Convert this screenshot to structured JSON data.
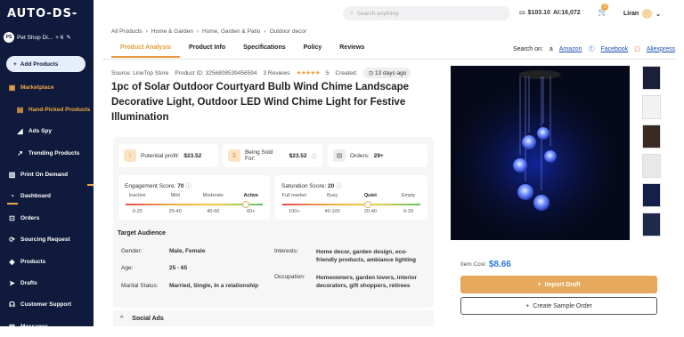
{
  "brand": "AUTO-DS-",
  "sidebar": {
    "store_initials": "PS",
    "store_name": "Pet Shop Di...",
    "store_extra": "+ 6",
    "add_products": "Add Products",
    "items": [
      {
        "label": "Marketplace"
      },
      {
        "label": "Hand-Picked Products"
      },
      {
        "label": "Ads Spy"
      },
      {
        "label": "Trending Products"
      },
      {
        "label": "Print On Demand"
      },
      {
        "label": "Dashboard"
      },
      {
        "label": "Orders"
      },
      {
        "label": "Sourcing Request"
      },
      {
        "label": "Products"
      },
      {
        "label": "Drafts"
      },
      {
        "label": "Customer Support"
      },
      {
        "label": "Messages"
      }
    ]
  },
  "topbar": {
    "search_placeholder": "Search anything",
    "balance": "$103.10",
    "ai_credits": "AI:16,072",
    "cart_count": "1",
    "user": "Liran"
  },
  "breadcrumb": [
    "All Products",
    "Home & Garden",
    "Home, Garden & Patio",
    "Outdoor decor"
  ],
  "tabs": [
    "Product Analysis",
    "Product Info",
    "Specifications",
    "Policy",
    "Reviews"
  ],
  "search_on": {
    "label": "Search on:",
    "links": [
      "Amazon",
      "Facebook",
      "Aliexpress"
    ]
  },
  "meta": {
    "source": "Source: LineTop Store",
    "product_id": "Product ID: 3256808539456594",
    "reviews": "3 Reviews",
    "stars": "★★★★★",
    "rating": "5",
    "created_label": "Created:",
    "created": "13 days ago"
  },
  "title": "1pc of Solar Outdoor Courtyard Bulb Wind Chime Landscape Decorative Light, Outdoor LED Wind Chime Light for Festive Illumination",
  "stats": {
    "potential_profit_label": "Potential profit:",
    "potential_profit": "$23.52",
    "sold_for_label": "Being Sold For:",
    "sold_for": "$23.52",
    "orders_label": "Orders:",
    "orders": "29+"
  },
  "engagement": {
    "label": "Engagement Score:",
    "value": "70",
    "cats": [
      "Inactive",
      "Mild",
      "Moderate",
      "Active"
    ],
    "ranges": [
      "0-20",
      "20-40",
      "40-60",
      "60+"
    ]
  },
  "saturation": {
    "label": "Saturation Score:",
    "value": "20",
    "cats": [
      "Full market",
      "Busy",
      "Quiet",
      "Empty"
    ],
    "ranges": [
      "100+",
      "40-100",
      "20-40",
      "0-20"
    ]
  },
  "audience": {
    "title": "Target Audience",
    "gender_label": "Gender:",
    "gender": "Male, Female",
    "age_label": "Age:",
    "age": "25 - 65",
    "marital_label": "Marital Status:",
    "marital": "Married, Single, In a relationship",
    "interests_label": "Interests:",
    "interests": "Home decor, garden design, eco-friendly products, ambiance lighting",
    "occupation_label": "Occupation:",
    "occupation": "Homeowners, garden lovers, interior decorators, gift shoppers, retirees"
  },
  "social_ads": "Social Ads",
  "item_cost_label": "Item Cost",
  "item_cost": "$8.66",
  "import_draft": "Import Draft",
  "create_sample": "Create Sample Order",
  "colors": {
    "sidebar": "#0f1a3c",
    "accent": "#e69a3a",
    "link": "#1a4fb0",
    "price": "#2a7be0"
  }
}
